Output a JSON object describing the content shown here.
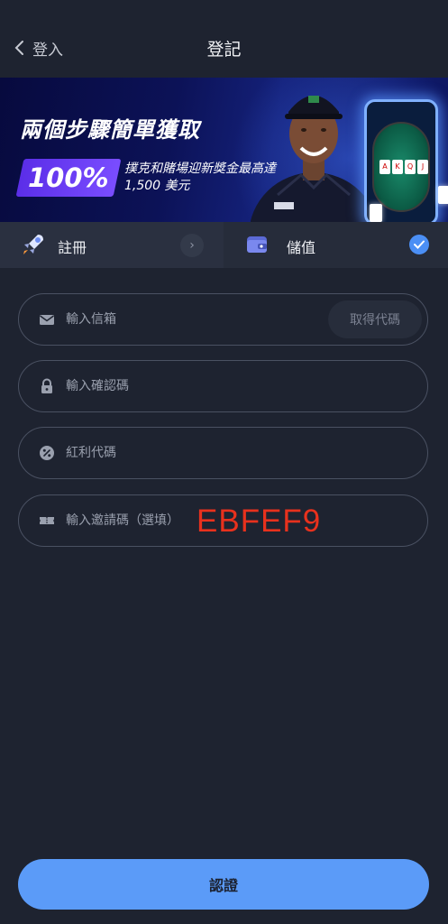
{
  "header": {
    "back_label": "登入",
    "title": "登記"
  },
  "banner": {
    "headline": "兩個步驟簡單獲取",
    "badge": "100%",
    "promo_line1": "撲克和賭場迎新獎金最高達",
    "promo_line2": "1,500 美元"
  },
  "steps": [
    {
      "label": "註冊",
      "icon": "rocket-icon",
      "state": "next"
    },
    {
      "label": "儲值",
      "icon": "wallet-icon",
      "state": "checked"
    }
  ],
  "form": {
    "email": {
      "placeholder": "輸入信箱",
      "value": "",
      "icon": "mail-icon",
      "action_label": "取得代碼"
    },
    "code": {
      "placeholder": "輸入確認碼",
      "value": "",
      "icon": "lock-icon"
    },
    "bonus": {
      "placeholder": "紅利代碼",
      "value": "",
      "icon": "percent-icon"
    },
    "invite": {
      "placeholder": "輸入邀請碼（選填）",
      "value": "",
      "icon": "ticket-icon",
      "overlay_code": "EBFEF9"
    }
  },
  "submit_label": "認證",
  "colors": {
    "background": "#1e2330",
    "accent": "#5b9bf8",
    "check": "#4b8ff5",
    "overlay_code": "#e8311d",
    "badge": "#6a3ef0"
  }
}
